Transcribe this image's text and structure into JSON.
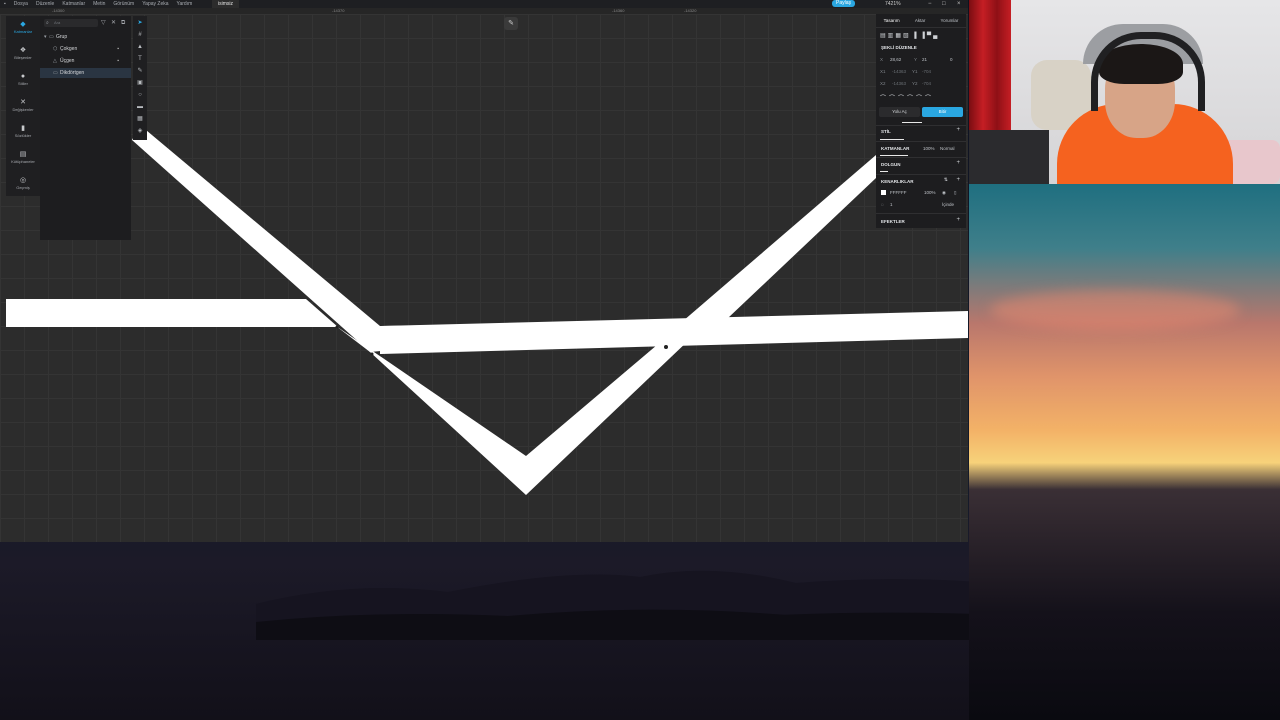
{
  "menubar": {
    "items": [
      "Dosya",
      "Düzenle",
      "Katmanlar",
      "Metin",
      "Görünüm",
      "Yapay Zeka",
      "Yardım"
    ],
    "tab_title": "isimsiz",
    "share_label": "Paylaş",
    "zoom_label": "7421%"
  },
  "ruler": {
    "marks": [
      "-14300",
      "-14370",
      "-14360",
      "-14320"
    ]
  },
  "left_rail": {
    "items": [
      {
        "label": "Katmanlar",
        "icon": "layers-icon"
      },
      {
        "label": "Bileşenler",
        "icon": "components-icon"
      },
      {
        "label": "Stiller",
        "icon": "styles-icon"
      },
      {
        "label": "Değişkenler",
        "icon": "variables-icon"
      },
      {
        "label": "Sözlükler",
        "icon": "dictionary-icon"
      },
      {
        "label": "Kütüphaneler",
        "icon": "library-icon"
      },
      {
        "label": "Geçmiş",
        "icon": "history-icon"
      }
    ]
  },
  "layers_panel": {
    "search_placeholder": "Ara",
    "rows": [
      {
        "label": "Grup",
        "icon": "group-icon"
      },
      {
        "label": "Çokgen",
        "icon": "polygon-icon"
      },
      {
        "label": "Üçgen",
        "icon": "triangle-icon"
      },
      {
        "label": "Dikdörtgen",
        "icon": "rectangle-icon"
      }
    ]
  },
  "right_panel": {
    "tabs": [
      "Tasarım",
      "Aktar",
      "Yorumlar"
    ],
    "section_shape_edit": "ŞEKLİ DÜZENLE",
    "x_label": "X",
    "x_value": "28,62",
    "y_label": "Y",
    "y_value": "21",
    "radius_value": "0",
    "x1_label": "X1",
    "x1_value": "-14363",
    "y1_label": "Y1",
    "y1_value": "-704",
    "x2_label": "X2",
    "x2_value": "-14363",
    "y2_label": "Y2",
    "y2_value": "-704",
    "edit_path_label": "Yolu Aç",
    "done_label": "Bitir",
    "style_label": "STİL",
    "layer_label": "KATMANLAR",
    "layer_opacity": "100%",
    "blend_mode": "Normal",
    "fill_label": "DOLGUN",
    "stroke_label": "KENARLIKLAR",
    "stroke_color_hex": "FFFFFF",
    "stroke_opacity": "100%",
    "stroke_width": "1",
    "stroke_position": "İçinde",
    "effects_label": "EFEKTLER"
  },
  "colors": {
    "accent": "#2aa7e1",
    "canvas": "#2c2c2c",
    "shape_fill": "#ffffff",
    "panel": "#1d1d1f"
  }
}
